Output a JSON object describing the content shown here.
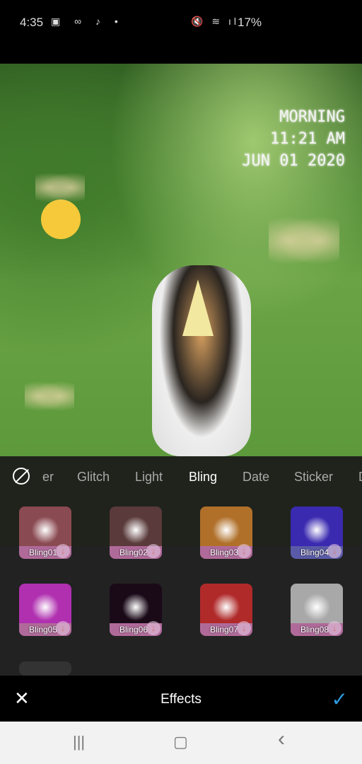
{
  "status_bar": {
    "time": "4:35",
    "left_icons": [
      "image-icon",
      "voicemail-icon",
      "tiktok-icon",
      "dot-icon"
    ],
    "right_icons": [
      "mute-icon",
      "wifi-icon",
      "signal-icon"
    ],
    "battery": "17%"
  },
  "photo": {
    "stamp_lines": [
      "MORNING",
      "11:21 AM",
      "JUN 01 2020"
    ]
  },
  "effects": {
    "tabs": [
      {
        "label": "er"
      },
      {
        "label": "Glitch"
      },
      {
        "label": "Light"
      },
      {
        "label": "Bling",
        "active": true
      },
      {
        "label": "Date"
      },
      {
        "label": "Sticker"
      },
      {
        "label": "D"
      }
    ],
    "items": [
      {
        "label": "Bling01",
        "bg": "#8a4a52",
        "strip": "#b06a9a"
      },
      {
        "label": "Bling02",
        "bg": "#5a3a3a",
        "strip": "#b06a9a"
      },
      {
        "label": "Bling03",
        "bg": "#b0702a",
        "strip": "#b06a9a"
      },
      {
        "label": "Bling04",
        "bg": "#3a2ab0",
        "strip": "#5a5aa8"
      },
      {
        "label": "Bling05",
        "bg": "#b030b0",
        "strip": "#b06a9a"
      },
      {
        "label": "Bling06",
        "bg": "#1a0a18",
        "strip": "#b06a9a"
      },
      {
        "label": "Bling07",
        "bg": "#b02a2a",
        "strip": "#b06a9a"
      },
      {
        "label": "Bling08",
        "bg": "#a8a8a8",
        "strip": "#b06a9a"
      }
    ]
  },
  "bottom_bar": {
    "title": "Effects",
    "close": "✕",
    "confirm": "✓",
    "accent": "#2d9be0"
  },
  "nav": {
    "recents": "|||",
    "home": "▢",
    "back": "‹"
  }
}
